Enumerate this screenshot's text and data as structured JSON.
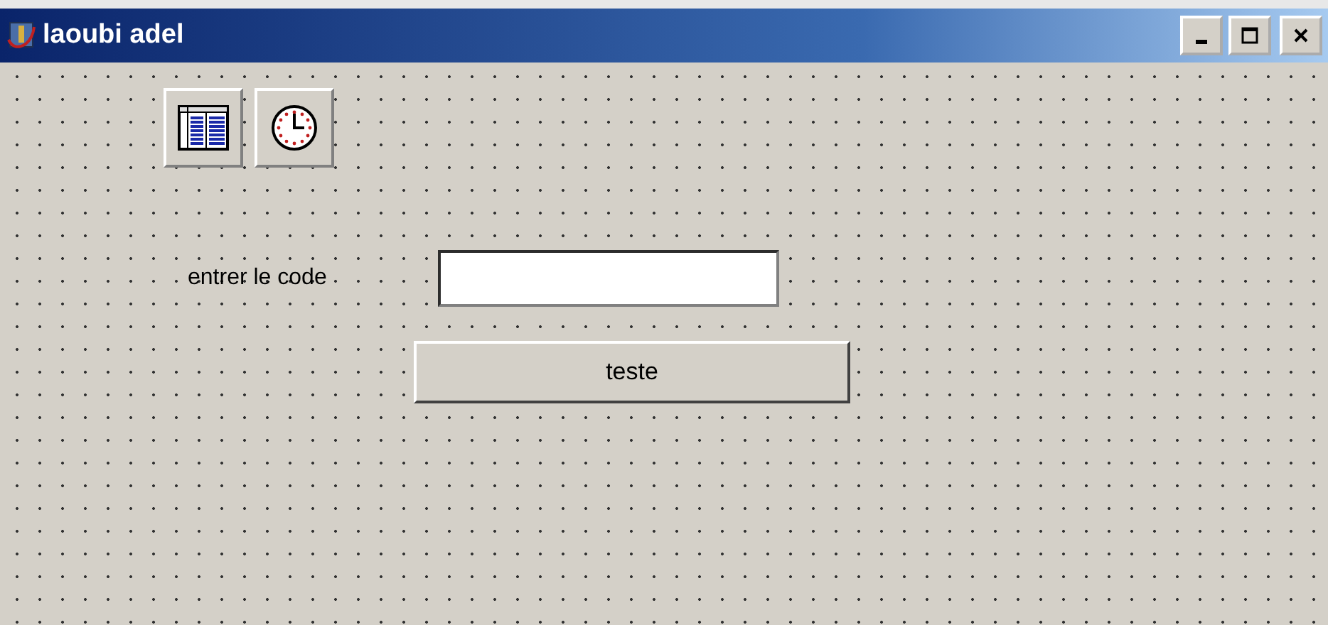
{
  "window": {
    "title": "laoubi adel"
  },
  "form": {
    "label": "entrer le code",
    "button": "teste"
  }
}
